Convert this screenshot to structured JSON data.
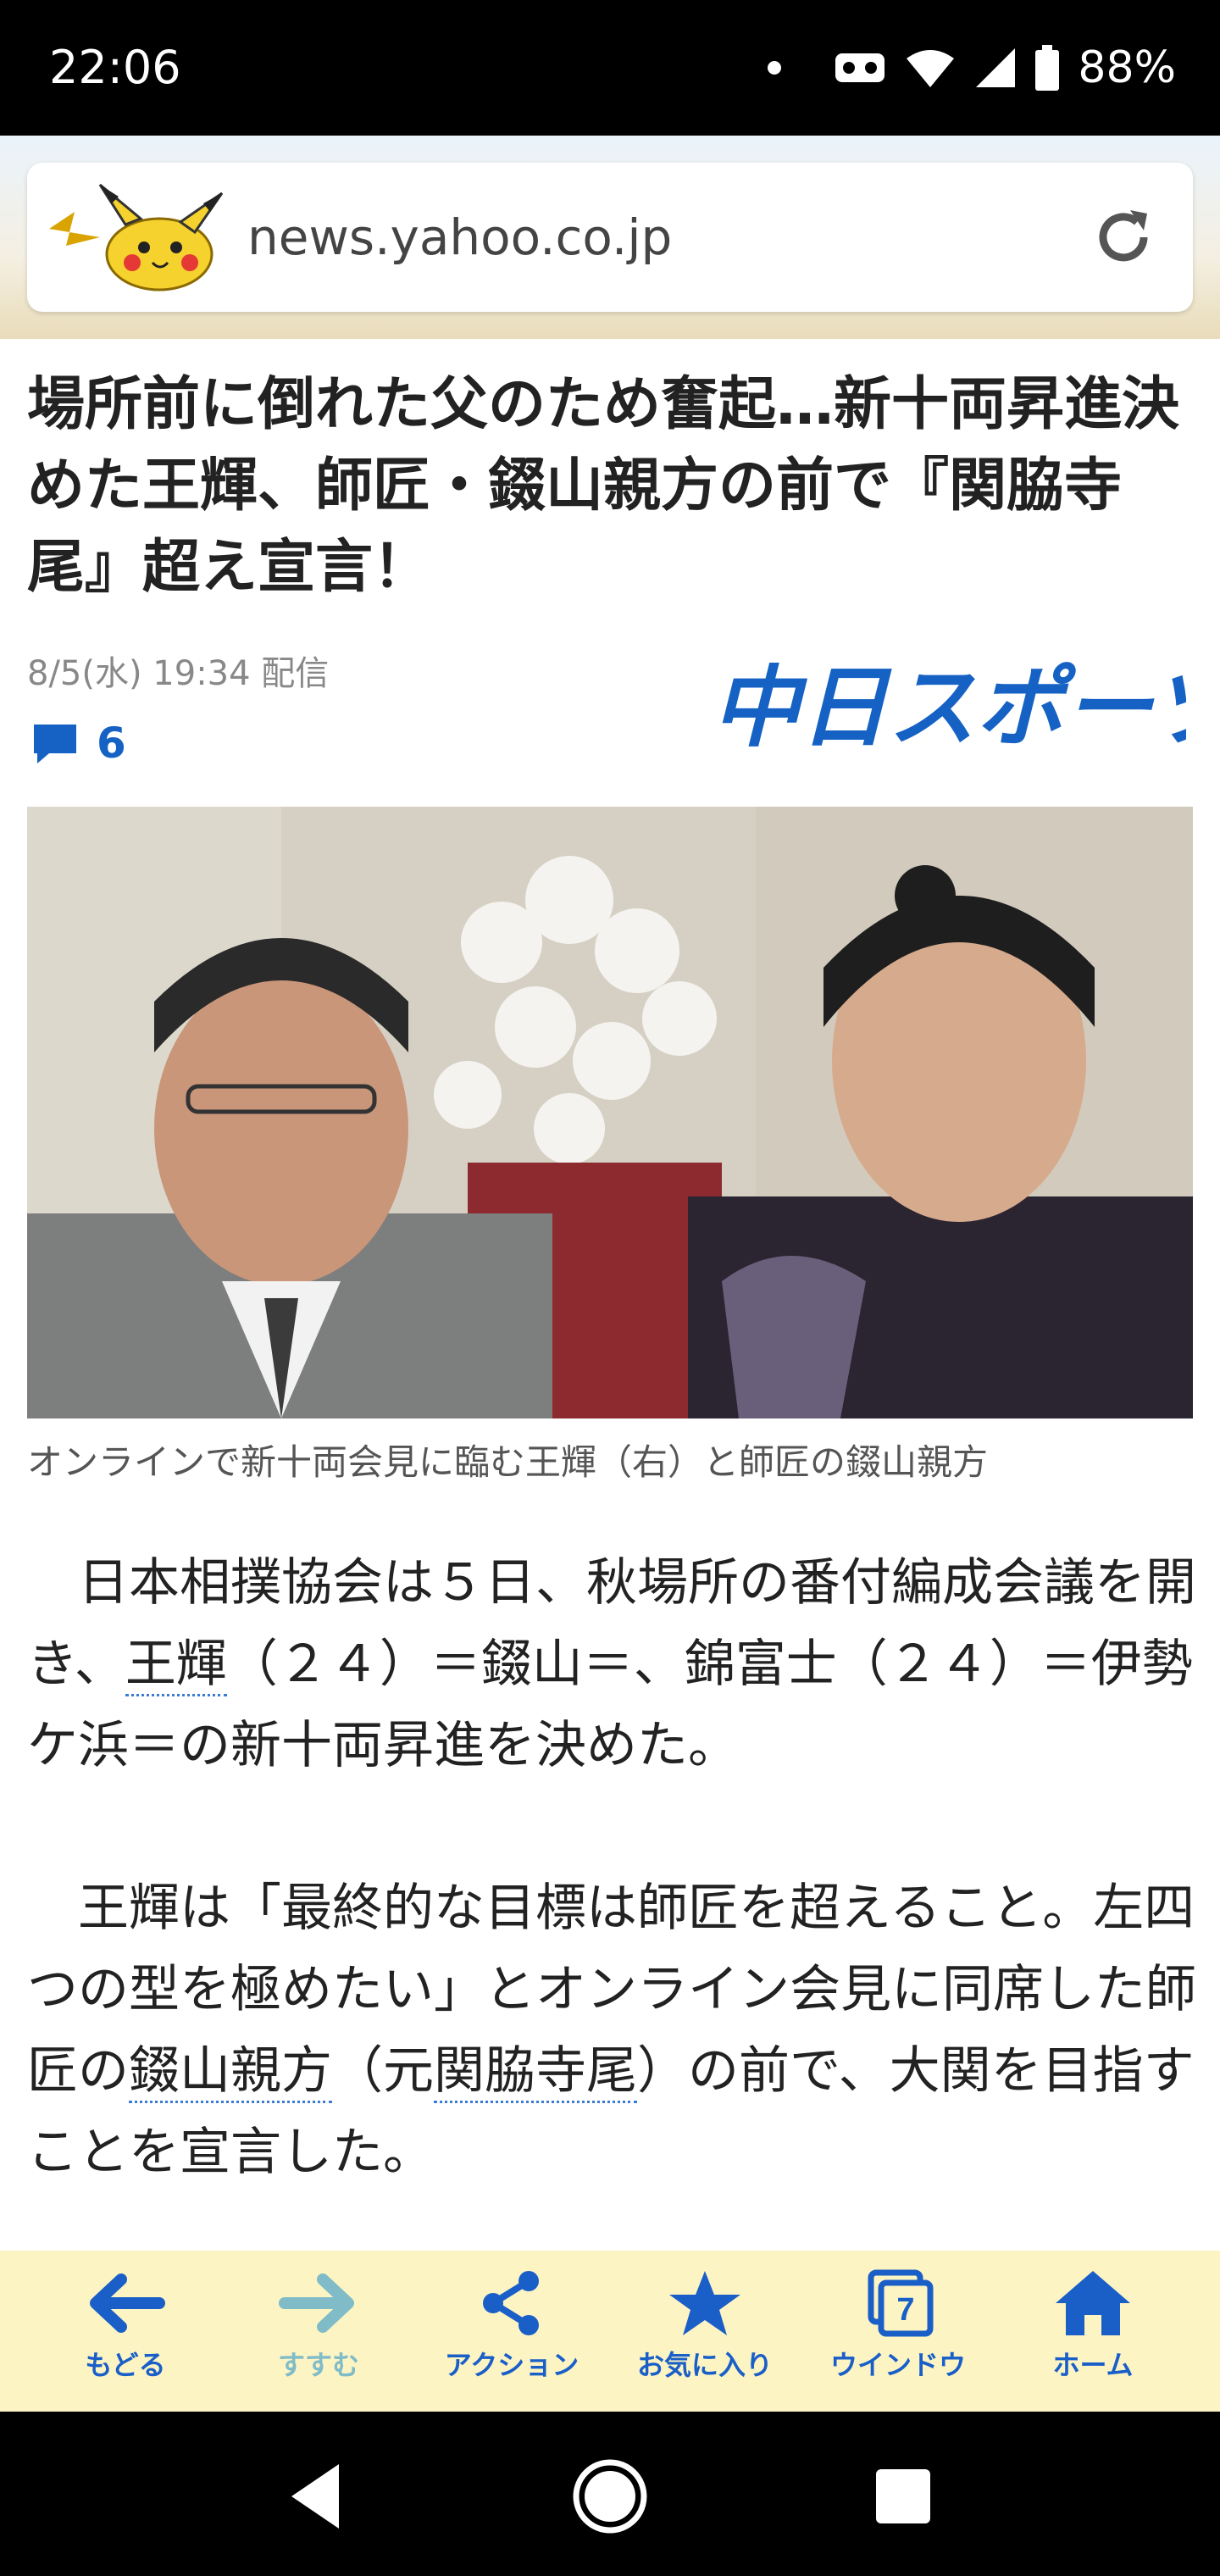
{
  "status_bar": {
    "time": "22:06",
    "battery": "88%"
  },
  "browser": {
    "url": "news.yahoo.co.jp"
  },
  "article": {
    "title": "場所前に倒れた父のため奮起…新十両昇進決めた王輝、師匠・錣山親方の前で『関脇寺尾』超え宣言！",
    "date": "8/5(水) 19:34 配信",
    "comment_count": "6",
    "source_logo": "中日スポーツ",
    "photo_caption": "オンラインで新十両会見に臨む王輝（右）と師匠の錣山親方",
    "p1_a": "日本相撲協会は５日、秋場所の番付編成会議を開き、",
    "p1_link": "王輝",
    "p1_b": "（２４）＝錣山＝、錦富士（２４）＝伊勢ケ浜＝の新十両昇進を決めた。",
    "p2_a": "王輝は「最終的な目標は師匠を超えること。左四つの型を極めたい」とオンライン会見に同席した師匠の",
    "p2_link1": "錣山親方",
    "p2_b": "（元",
    "p2_link2": "関脇寺尾",
    "p2_c": "）の前で、大関を目指すことを宣言した。"
  },
  "toolbar": {
    "back": "もどる",
    "forward": "すすむ",
    "action": "アクション",
    "favorites": "お気に入り",
    "window": "ウインドウ",
    "window_count": "7",
    "home": "ホーム"
  },
  "colors": {
    "accent": "#1a5fc8",
    "toolbar_bg": "#fdf4c4",
    "link_dot": "#3a7bd5"
  }
}
